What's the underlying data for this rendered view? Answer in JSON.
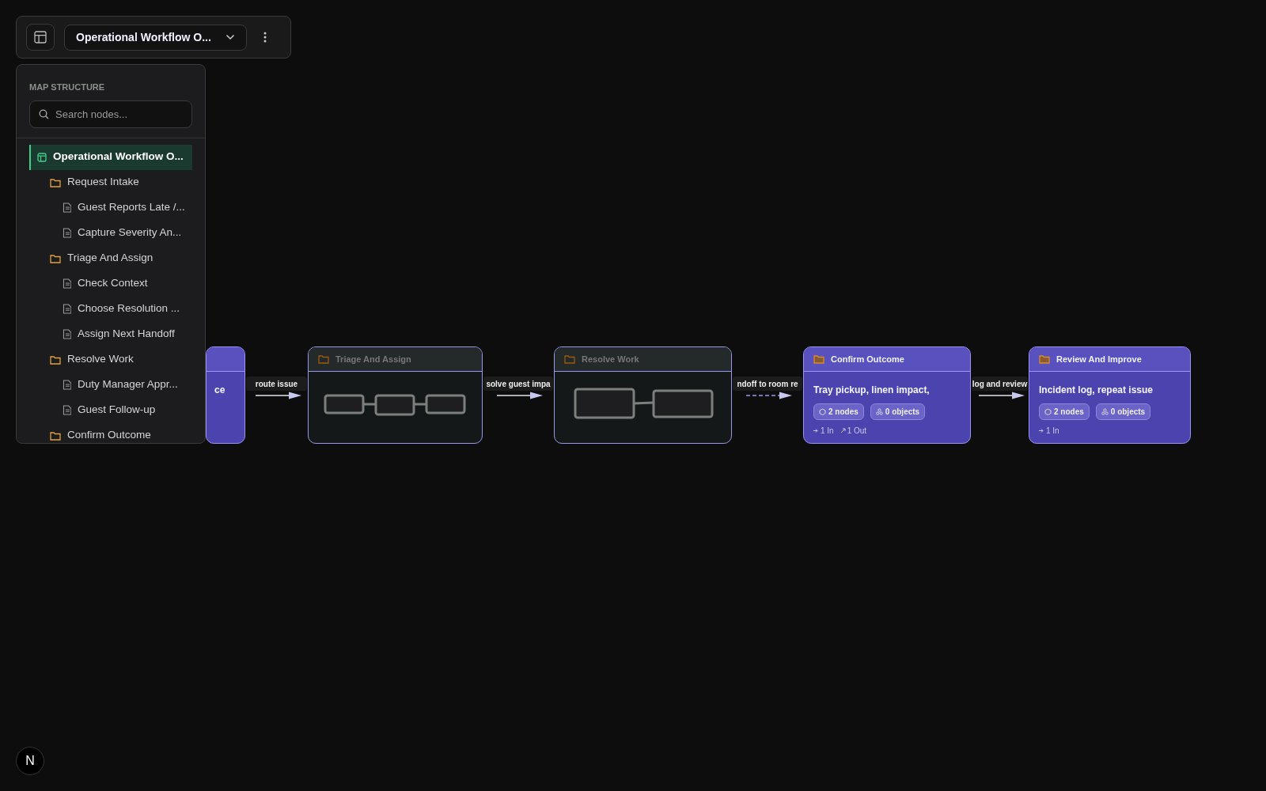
{
  "toolbar": {
    "map_title": "Operational Workflow O..."
  },
  "sidebar": {
    "heading": "MAP STRUCTURE",
    "search": {
      "placeholder": "Search nodes..."
    },
    "tree": [
      {
        "label": "Operational Workflow O...",
        "kind": "map",
        "selected": true,
        "children": [
          {
            "label": "Request Intake",
            "kind": "folder",
            "selected": false,
            "children": [
              {
                "label": "Guest Reports Late /...",
                "kind": "file",
                "selected": false
              },
              {
                "label": "Capture Severity An...",
                "kind": "file",
                "selected": false
              }
            ]
          },
          {
            "label": "Triage And Assign",
            "kind": "folder",
            "selected": false,
            "children": [
              {
                "label": "Check Context",
                "kind": "file",
                "selected": false
              },
              {
                "label": "Choose Resolution ...",
                "kind": "file",
                "selected": false
              },
              {
                "label": "Assign Next Handoff",
                "kind": "file",
                "selected": false
              }
            ]
          },
          {
            "label": "Resolve Work",
            "kind": "folder",
            "selected": false,
            "children": [
              {
                "label": "Duty Manager Appr...",
                "kind": "file",
                "selected": false
              },
              {
                "label": "Guest Follow-up",
                "kind": "file",
                "selected": false
              }
            ]
          },
          {
            "label": "Confirm Outcome",
            "kind": "folder",
            "selected": false
          }
        ]
      }
    ]
  },
  "canvas": {
    "nodes": [
      {
        "kind": "detail",
        "description": "ce"
      },
      {
        "kind": "preview",
        "title": "Triage And Assign"
      },
      {
        "kind": "preview",
        "title": "Resolve Work"
      },
      {
        "kind": "detail",
        "title": "Confirm Outcome",
        "description": "Tray pickup, linen impact,",
        "badges": [
          {
            "label": "2 nodes",
            "kind": "nodes"
          },
          {
            "label": "0 objects",
            "kind": "objects"
          }
        ],
        "links": [
          {
            "label": "1 In",
            "kind": "in"
          },
          {
            "label": "1 Out",
            "kind": "out"
          }
        ]
      },
      {
        "kind": "detail",
        "title": "Review And Improve",
        "description": "Incident log, repeat issue",
        "badges": [
          {
            "label": "2 nodes",
            "kind": "nodes"
          },
          {
            "label": "0 objects",
            "kind": "objects"
          }
        ],
        "links": [
          {
            "label": "1 In",
            "kind": "in"
          }
        ]
      }
    ],
    "edges": [
      {
        "label": "route issue",
        "kind": "solid"
      },
      {
        "label": "solve guest impa",
        "kind": "solid"
      },
      {
        "label": "ndoff to room re",
        "kind": "dashed"
      },
      {
        "label": "log and review",
        "kind": "solid"
      }
    ]
  },
  "dev_badge": "N"
}
